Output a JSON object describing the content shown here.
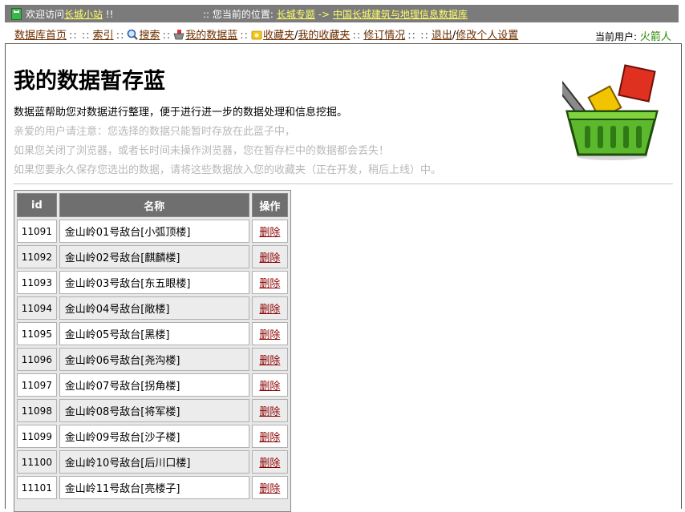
{
  "topbar": {
    "welcome_prefix": "欢迎访问",
    "site_link": "长城小站",
    "welcome_suffix": "!!",
    "location_label": ":: 您当前的位置:",
    "loc_link1": "长城专题",
    "loc_arrow": "->",
    "loc_link2": "中国长城建筑与地理信息数据库"
  },
  "nav": {
    "home": "数据库首页",
    "sep": "::",
    "index": "索引",
    "search": "搜索",
    "basket": "我的数据蓝",
    "favorites": "收藏夹",
    "my_favorites": "我的收藏夹",
    "revisions": "修订情况",
    "logout": "退出",
    "edit_profile": "修改个人设置",
    "slash": "/",
    "current_user_label": "当前用户:",
    "current_user": "火箭人"
  },
  "main": {
    "title": "我的数据暂存蓝",
    "description": "数据蓝帮助您对数据进行整理，便于进行进一步的数据处理和信息挖掘。",
    "notes": [
      "亲爱的用户请注意：您选择的数据只能暂时存放在此蓝子中，",
      "如果您关闭了浏览器，或者长时间未操作浏览器，您在暂存栏中的数据都会丢失！",
      "如果您要永久保存您选出的数据，请将这些数据放入您的收藏夹（正在开发，稍后上线）中。"
    ]
  },
  "table": {
    "headers": {
      "id": "id",
      "name": "名称",
      "op": "操作"
    },
    "delete_label": "删除",
    "rows": [
      {
        "id": "11091",
        "name": "金山岭01号敌台[小弧顶楼]"
      },
      {
        "id": "11092",
        "name": "金山岭02号敌台[麒麟楼]"
      },
      {
        "id": "11093",
        "name": "金山岭03号敌台[东五眼楼]"
      },
      {
        "id": "11094",
        "name": "金山岭04号敌台[敞楼]"
      },
      {
        "id": "11095",
        "name": "金山岭05号敌台[黑楼]"
      },
      {
        "id": "11096",
        "name": "金山岭06号敌台[尧沟楼]"
      },
      {
        "id": "11097",
        "name": "金山岭07号敌台[拐角楼]"
      },
      {
        "id": "11098",
        "name": "金山岭08号敌台[将军楼]"
      },
      {
        "id": "11099",
        "name": "金山岭09号敌台[沙子楼]"
      },
      {
        "id": "11100",
        "name": "金山岭10号敌台[后川口楼]"
      },
      {
        "id": "11101",
        "name": "金山岭11号敌台[亮楼子]"
      }
    ]
  },
  "colors": {
    "topbar_bg": "#7b7b7b",
    "topbar_link": "#ffff66",
    "nav_link": "#6b2f00",
    "delete_link": "#8b0000",
    "user_name": "#2a8a00",
    "note_text": "#b8b8b8",
    "header_bg": "#6f6f6f"
  },
  "icons": {
    "logo": "great-wall-logo-icon",
    "search": "magnifier-icon",
    "basket": "basket-small-icon",
    "favorites": "folder-star-icon",
    "hero": "shopping-basket-icon"
  }
}
